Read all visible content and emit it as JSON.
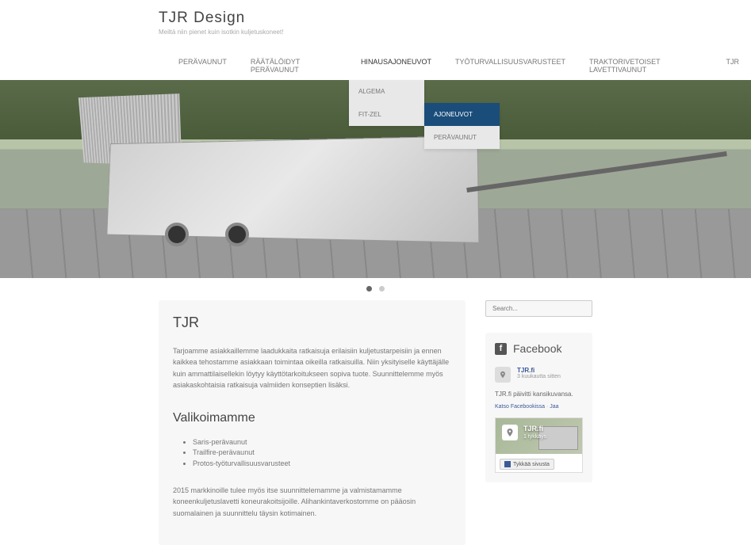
{
  "site": {
    "title": "TJR Design",
    "tagline": "Meiltä niin pienet kuin isotkin kuljetuskoneet!"
  },
  "nav": {
    "items": [
      {
        "label": "PERÄVAUNUT"
      },
      {
        "label": "RÄÄTÄLÖIDYT PERÄVAUNUT"
      },
      {
        "label": "HINAUSAJONEUVOT",
        "submenu": [
          {
            "label": "ALGEMA"
          },
          {
            "label": "FIT-ZEL",
            "submenu": [
              {
                "label": "AJONEUVOT",
                "highlighted": true
              },
              {
                "label": "PERÄVAUNUT"
              }
            ]
          }
        ]
      },
      {
        "label": "TYÖTURVALLISUUSVARUSTEET"
      },
      {
        "label": "TRAKTORIVETOISET LAVETTIVAUNUT"
      },
      {
        "label": "TJR"
      }
    ]
  },
  "content": {
    "title": "TJR",
    "intro": "Tarjoamme asiakkaillemme laadukkaita ratkaisuja erilaisiin kuljetustarpeisiin ja ennen kaikkea tehostamme asiakkaan toimintaa oikeilla ratkaisuilla. Niin yksityiselle käyttäjälle kuin ammattilaisellekin löytyy käyttötarkoitukseen sopiva tuote. Suunnittelemme myös asiakaskohtaisia ratkaisuja valmiiden konseptien lisäksi.",
    "section_title": "Valikoimamme",
    "items": [
      "Saris-perävaunut",
      "Trailfire-perävaunut",
      "Protos-työturvallisuusvarusteet"
    ],
    "bottom": "2015 markkinoille tulee myös itse suunnittelemamme ja valmistamamme koneenkuljetuslavetti koneurakoitsijoille. Alihankintaverkostomme on pääosin suomalainen ja suunnittelu täysin kotimainen."
  },
  "search": {
    "placeholder": "Search..."
  },
  "facebook": {
    "title": "Facebook",
    "post_title": "TJR.fi",
    "post_time": "3 kuukautta sitten",
    "post_text": "TJR.fi päivitti kansikuvansa.",
    "link_view": "Katso Facebookissa",
    "link_sep": " · ",
    "link_share": "Jaa",
    "page_name": "TJR.fi",
    "page_likes": "1 tykkäys",
    "like_button": "Tykkää sivusta"
  }
}
